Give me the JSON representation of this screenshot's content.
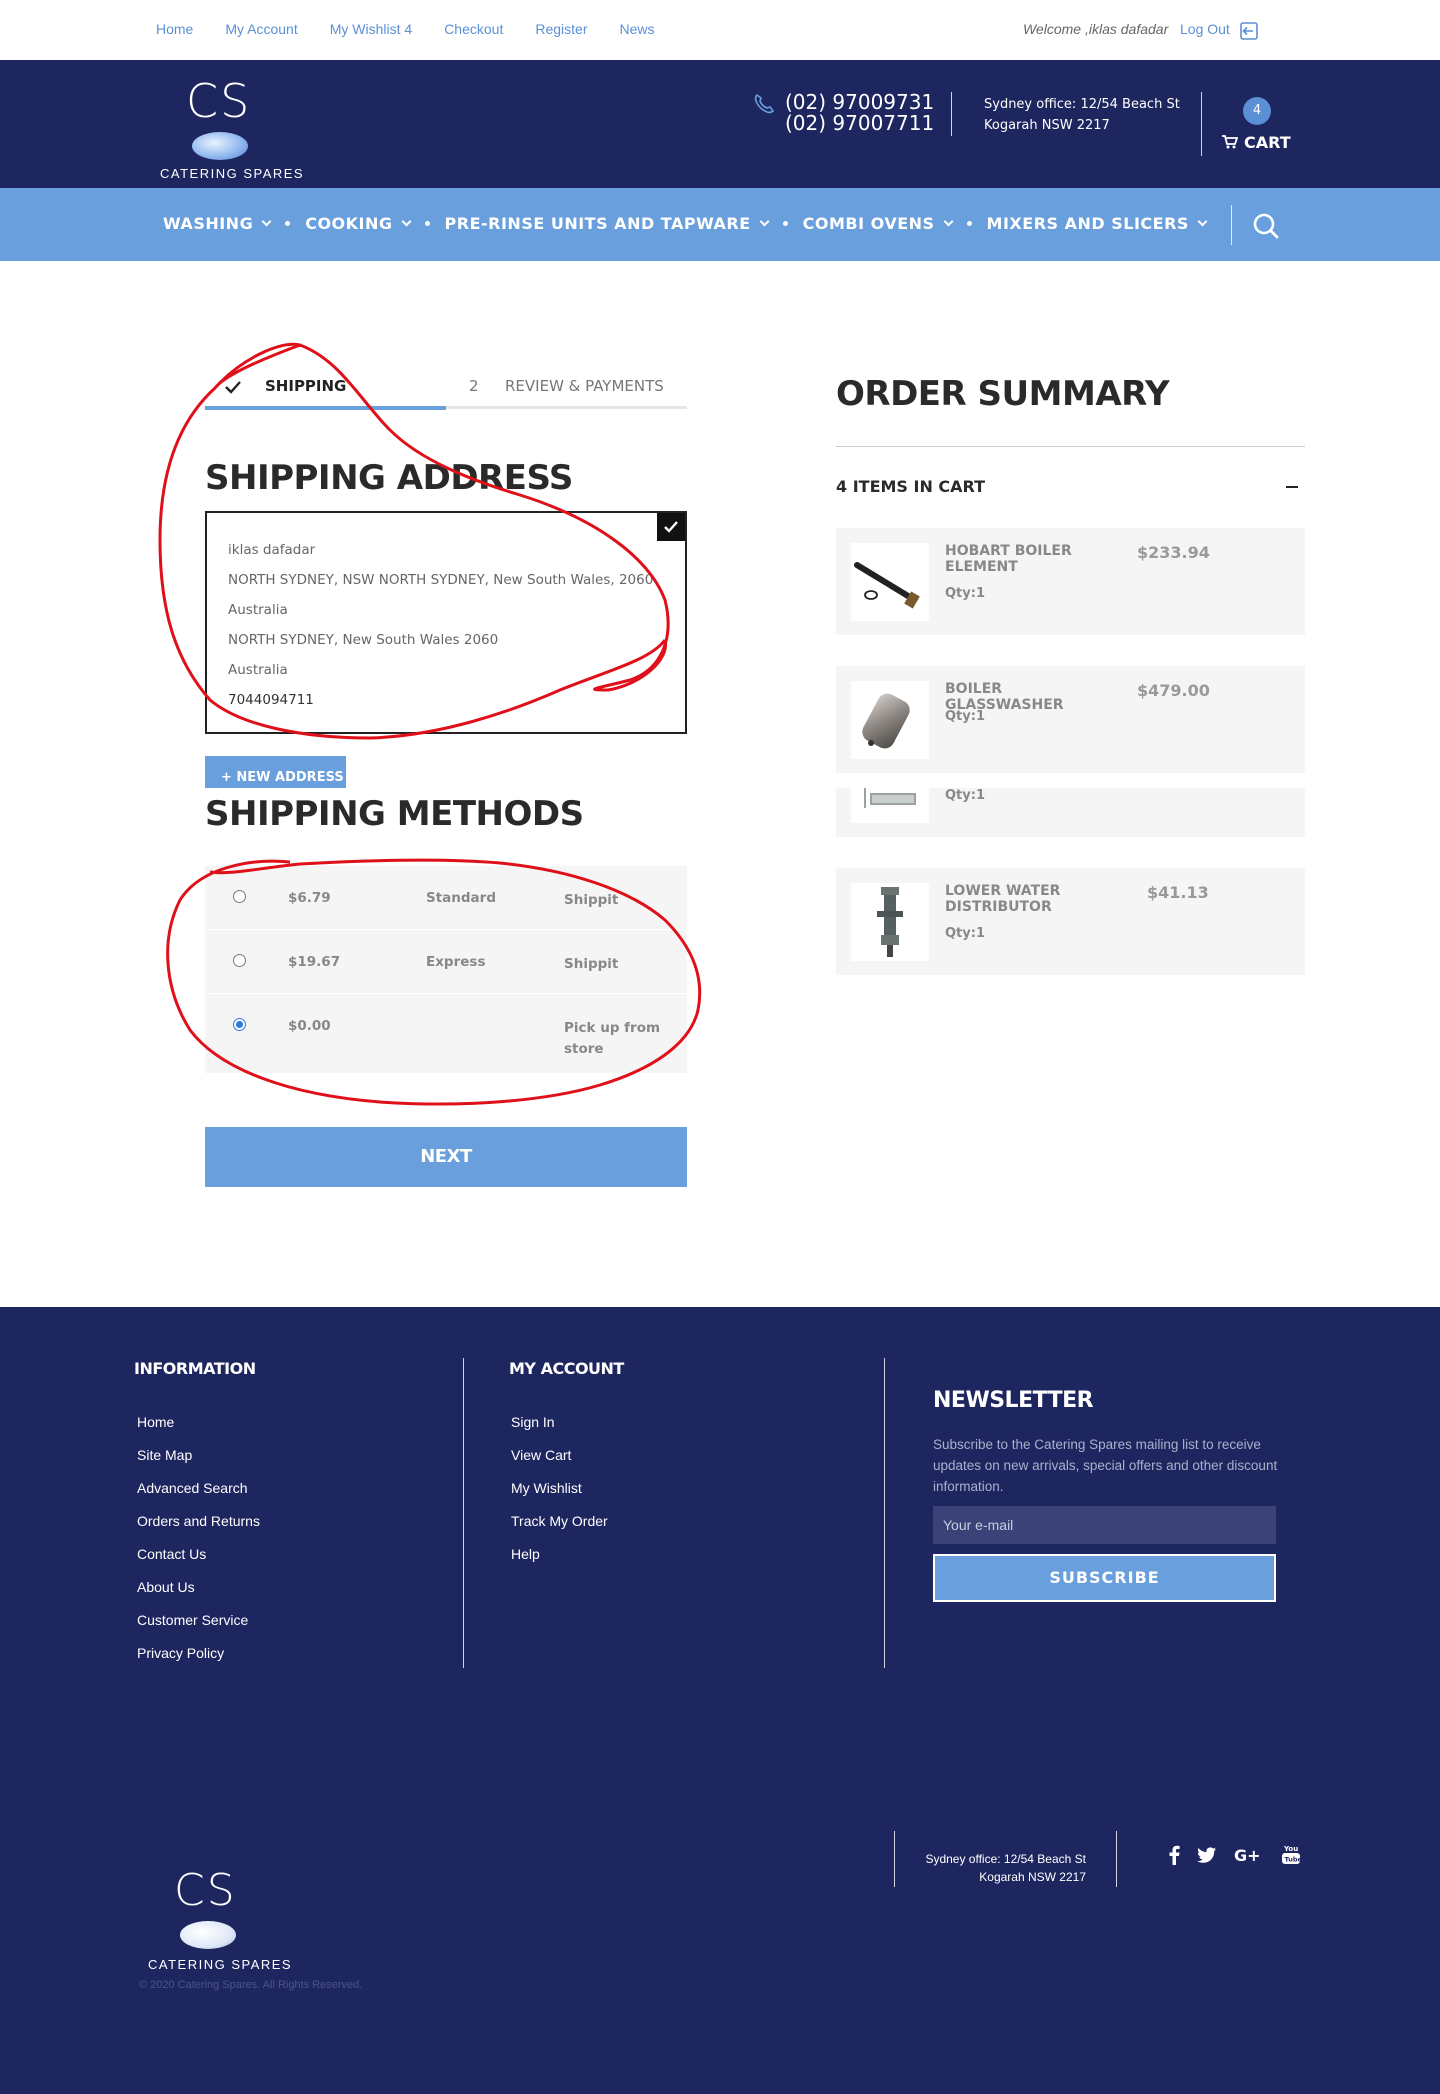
{
  "topbar": {
    "links": [
      "Home",
      "My Account",
      "My Wishlist 4",
      "Checkout",
      "Register",
      "News"
    ],
    "welcome": "Welcome ,iklas dafadar",
    "logout": "Log Out"
  },
  "header": {
    "logo_letters": "CS",
    "logo_tagline": "CATERING SPARES",
    "phone1": "(02) 97009731",
    "phone2": "(02) 97007711",
    "office_line1": "Sydney office: 12/54 Beach St",
    "office_line2": "Kogarah NSW 2217",
    "cart_count": "4",
    "cart_label": "CART"
  },
  "nav": {
    "items": [
      "WASHING",
      "COOKING",
      "PRE-RINSE UNITS AND TAPWARE",
      "COMBI OVENS",
      "MIXERS AND SLICERS"
    ]
  },
  "steps": {
    "step1_label": "SHIPPING",
    "step2_number": "2",
    "step2_label": "REVIEW & PAYMENTS"
  },
  "shipping_address": {
    "title": "SHIPPING ADDRESS",
    "lines": [
      "iklas dafadar",
      "NORTH SYDNEY, NSW NORTH SYDNEY, New South Wales, 2060",
      "Australia",
      "NORTH SYDNEY, New South Wales 2060",
      "Australia",
      "7044094711"
    ],
    "new_address_button": "+ NEW ADDRESS"
  },
  "shipping_methods": {
    "title": "SHIPPING METHODS",
    "options": [
      {
        "price": "$6.79",
        "method": "Standard",
        "carrier": "Shippit",
        "selected": false
      },
      {
        "price": "$19.67",
        "method": "Express",
        "carrier": "Shippit",
        "selected": false
      },
      {
        "price": "$0.00",
        "method": "",
        "carrier": "Pick up from store",
        "selected": true
      }
    ],
    "next_button": "NEXT"
  },
  "order_summary": {
    "title": "ORDER SUMMARY",
    "items_in_cart": "4 ITEMS IN CART",
    "items": [
      {
        "name": "HOBART BOILER ELEMENT",
        "price": "$233.94",
        "qty": "Qty:1"
      },
      {
        "name": "BOILER GLASSWASHER",
        "price": "$479.00",
        "qty": "Qty:1"
      },
      {
        "name": "",
        "price": "",
        "qty": "Qty:1"
      },
      {
        "name": "LOWER WATER DISTRIBUTOR",
        "price": "$41.13",
        "qty": "Qty:1"
      }
    ]
  },
  "footer": {
    "information_title": "INFORMATION",
    "information_links": [
      "Home",
      "Site Map",
      "Advanced Search",
      "Orders and Returns",
      "Contact Us",
      "About Us",
      "Customer Service",
      "Privacy Policy"
    ],
    "account_title": "MY ACCOUNT",
    "account_links": [
      "Sign In",
      "View Cart",
      "My Wishlist",
      "Track My Order",
      "Help"
    ],
    "newsletter_title": "NEWSLETTER",
    "newsletter_text": "Subscribe to the Catering Spares mailing list to receive updates on new arrivals, special offers and other discount information.",
    "email_placeholder": "Your e-mail",
    "subscribe_button": "SUBSCRIBE",
    "office_line1": "Sydney office: 12/54 Beach St",
    "office_line2": "Kogarah NSW 2217",
    "social_icons": [
      "facebook-icon",
      "twitter-icon",
      "google-plus-icon",
      "youtube-icon"
    ],
    "logo_letters": "CS",
    "logo_tagline": "CATERING SPARES",
    "copyright": "© 2020 Catering Spares. All Rights Reserved."
  },
  "colors": {
    "navy": "#1e2660",
    "accent_blue": "#6a9fdd",
    "link_blue": "#5b8fd6",
    "annotation_red": "#e0101a"
  }
}
